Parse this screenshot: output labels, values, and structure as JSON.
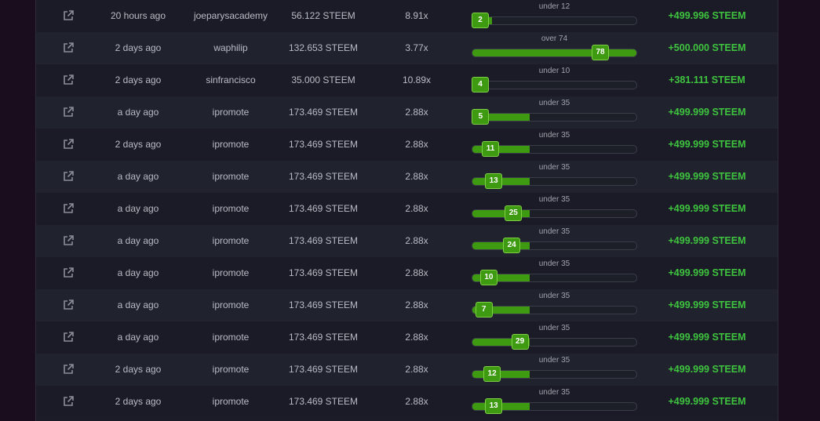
{
  "colors": {
    "accent_green": "#3e9a10",
    "profit_green": "#3ec43e"
  },
  "icons": {
    "row_link": "external-link-icon"
  },
  "rows": [
    {
      "time": "20 hours ago",
      "user": "joeparysacademy",
      "amount": "56.122 STEEM",
      "multiplier": "8.91x",
      "rank_label": "under 12",
      "rank": "2",
      "fill_pct": 12,
      "profit": "+499.996 STEEM"
    },
    {
      "time": "2 days ago",
      "user": "waphilip",
      "amount": "132.653 STEEM",
      "multiplier": "3.77x",
      "rank_label": "over 74",
      "rank": "78",
      "fill_pct": 100,
      "profit": "+500.000 STEEM"
    },
    {
      "time": "2 days ago",
      "user": "sinfrancisco",
      "amount": "35.000 STEEM",
      "multiplier": "10.89x",
      "rank_label": "under 10",
      "rank": "4",
      "fill_pct": 10,
      "profit": "+381.111 STEEM"
    },
    {
      "time": "a day ago",
      "user": "ipromote",
      "amount": "173.469 STEEM",
      "multiplier": "2.88x",
      "rank_label": "under 35",
      "rank": "5",
      "fill_pct": 35,
      "profit": "+499.999 STEEM"
    },
    {
      "time": "2 days ago",
      "user": "ipromote",
      "amount": "173.469 STEEM",
      "multiplier": "2.88x",
      "rank_label": "under 35",
      "rank": "11",
      "fill_pct": 35,
      "profit": "+499.999 STEEM"
    },
    {
      "time": "a day ago",
      "user": "ipromote",
      "amount": "173.469 STEEM",
      "multiplier": "2.88x",
      "rank_label": "under 35",
      "rank": "13",
      "fill_pct": 35,
      "profit": "+499.999 STEEM"
    },
    {
      "time": "a day ago",
      "user": "ipromote",
      "amount": "173.469 STEEM",
      "multiplier": "2.88x",
      "rank_label": "under 35",
      "rank": "25",
      "fill_pct": 35,
      "profit": "+499.999 STEEM"
    },
    {
      "time": "a day ago",
      "user": "ipromote",
      "amount": "173.469 STEEM",
      "multiplier": "2.88x",
      "rank_label": "under 35",
      "rank": "24",
      "fill_pct": 35,
      "profit": "+499.999 STEEM"
    },
    {
      "time": "a day ago",
      "user": "ipromote",
      "amount": "173.469 STEEM",
      "multiplier": "2.88x",
      "rank_label": "under 35",
      "rank": "10",
      "fill_pct": 35,
      "profit": "+499.999 STEEM"
    },
    {
      "time": "a day ago",
      "user": "ipromote",
      "amount": "173.469 STEEM",
      "multiplier": "2.88x",
      "rank_label": "under 35",
      "rank": "7",
      "fill_pct": 35,
      "profit": "+499.999 STEEM"
    },
    {
      "time": "a day ago",
      "user": "ipromote",
      "amount": "173.469 STEEM",
      "multiplier": "2.88x",
      "rank_label": "under 35",
      "rank": "29",
      "fill_pct": 35,
      "profit": "+499.999 STEEM"
    },
    {
      "time": "2 days ago",
      "user": "ipromote",
      "amount": "173.469 STEEM",
      "multiplier": "2.88x",
      "rank_label": "under 35",
      "rank": "12",
      "fill_pct": 35,
      "profit": "+499.999 STEEM"
    },
    {
      "time": "2 days ago",
      "user": "ipromote",
      "amount": "173.469 STEEM",
      "multiplier": "2.88x",
      "rank_label": "under 35",
      "rank": "13",
      "fill_pct": 35,
      "profit": "+499.999 STEEM"
    }
  ]
}
